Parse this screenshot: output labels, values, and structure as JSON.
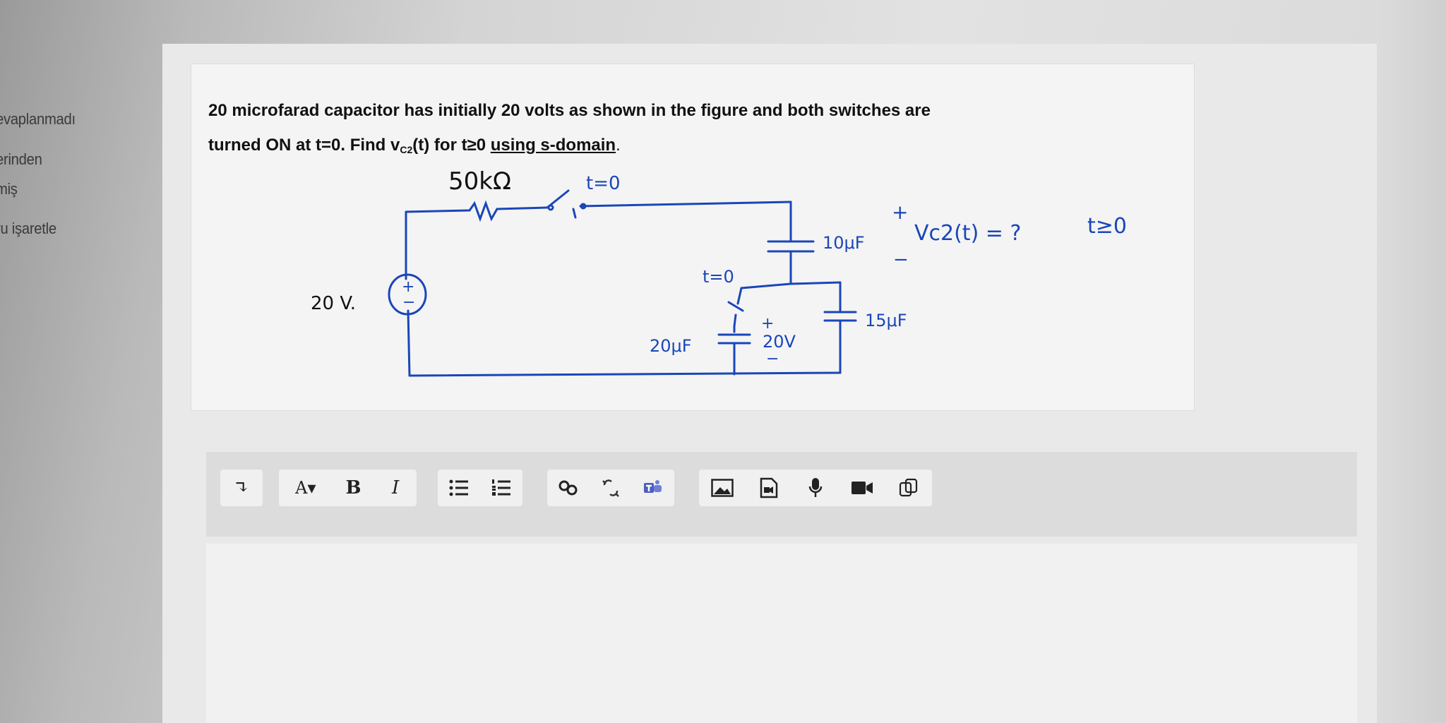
{
  "sidebar": {
    "items": [
      {
        "label": "evaplanmadı"
      },
      {
        "label": "erinden"
      },
      {
        "label": "miş"
      },
      {
        "label": "ru işaretle"
      }
    ]
  },
  "question": {
    "line1": "20 microfarad capacitor has initially 20 volts as shown in the figure and both switches are",
    "line2_prefix": "turned ON at t=0. Find v",
    "line2_sub": "C2",
    "line2_mid": "(t) for t≥0 ",
    "line2_underlined": "using s-domain",
    "line2_end": "."
  },
  "figure": {
    "resistor_label": "50kΩ",
    "switch1_label": "t=0",
    "cap1_label": "10μF",
    "plus_sign": "+",
    "minus_sign": "−",
    "vc2_expr": "Vc2(t) = ?",
    "time_cond": "t≥0",
    "switch2_label": "t=0",
    "source_label": "20 V.",
    "source_plus": "+",
    "source_minus": "−",
    "cap2_label": "20μF",
    "cap2_plus": "+",
    "cap2_voltage": "20V",
    "cap2_minus": "−",
    "cap3_label": "15μF"
  },
  "toolbar": {
    "expand_glyph": "↴",
    "font_glyph": "A▾",
    "bold_glyph": "B",
    "italic_glyph": "I"
  },
  "colors": {
    "ink": "#1a46b8",
    "panel": "#e9e9e9"
  }
}
